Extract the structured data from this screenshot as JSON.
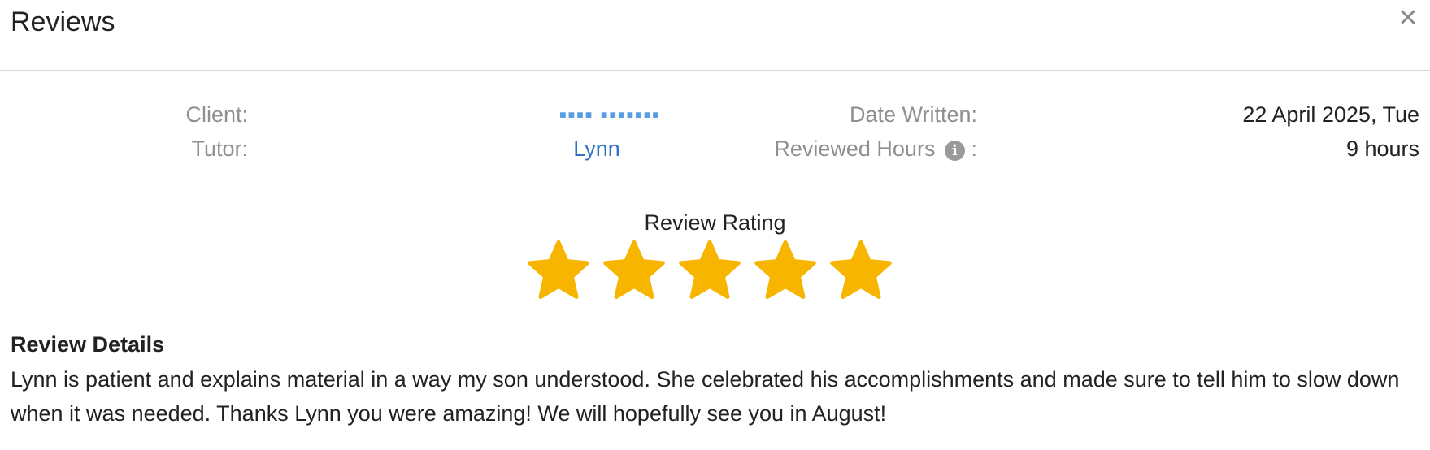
{
  "dialog": {
    "title": "Reviews",
    "close_icon": "close-icon"
  },
  "info": {
    "client_label": "Client:",
    "client_value": "▪▪▪▪ ▪▪▪▪▪▪▪",
    "tutor_label": "Tutor:",
    "tutor_value": "Lynn",
    "date_label": "Date Written:",
    "date_value": "22 April 2025, Tue",
    "hours_label": "Reviewed Hours",
    "hours_suffix": ":",
    "hours_icon": "info-icon",
    "hours_icon_glyph": "i",
    "hours_value": "9 hours"
  },
  "rating": {
    "title": "Review Rating",
    "value": 5,
    "max": 5,
    "star_color": "#f7b500"
  },
  "details": {
    "heading": "Review Details",
    "text": "Lynn is patient and explains material in a way my son understood. She celebrated his accomplishments and made sure to tell him to slow down when it was needed. Thanks Lynn you were amazing! We will hopefully see you in August!"
  },
  "colors": {
    "link": "#2f72c4",
    "label": "#8f8f8f",
    "text": "#222222"
  }
}
